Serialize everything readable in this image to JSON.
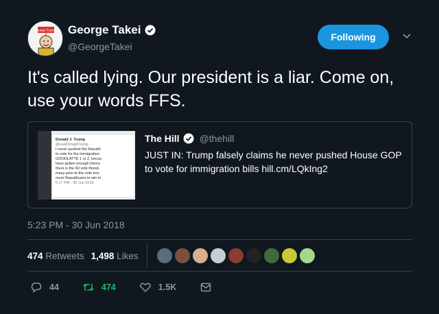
{
  "author": {
    "name": "George Takei",
    "handle": "@GeorgeTakei",
    "avatar_sign_text": "Dump Trump"
  },
  "follow_button_label": "Following",
  "tweet_text": "It's called lying. Our president is a liar. Come on, use your words FFS.",
  "quoted": {
    "name": "The Hill",
    "handle": "@thehill",
    "text": "JUST IN: Trump falsely claims he never pushed House GOP to vote for immigration bills hill.cm/LQkIng2",
    "image_lines": [
      "Donald J. Trump",
      "@realDonaldTrump",
      "I never pushed the Republi",
      "to vote for the Immigration",
      "GOODLATTE 1 or 2, becau",
      "have gotten enough Demo",
      "there is the 60 vote thresh",
      "many prior to the vote kno",
      "more Republicans to win in",
      "6:17 PM - 30 Jun 2018"
    ]
  },
  "timestamp": "5:23 PM - 30 Jun 2018",
  "stats": {
    "retweets_count": "474",
    "retweets_label": "Retweets",
    "likes_count": "1,498",
    "likes_label": "Likes"
  },
  "actions": {
    "reply_count": "44",
    "retweet_count": "474",
    "like_count": "1.5K"
  },
  "colors": {
    "background": "#10171e",
    "accent": "#1b95e0",
    "muted": "#8899a6",
    "retweet": "#17bf63"
  }
}
